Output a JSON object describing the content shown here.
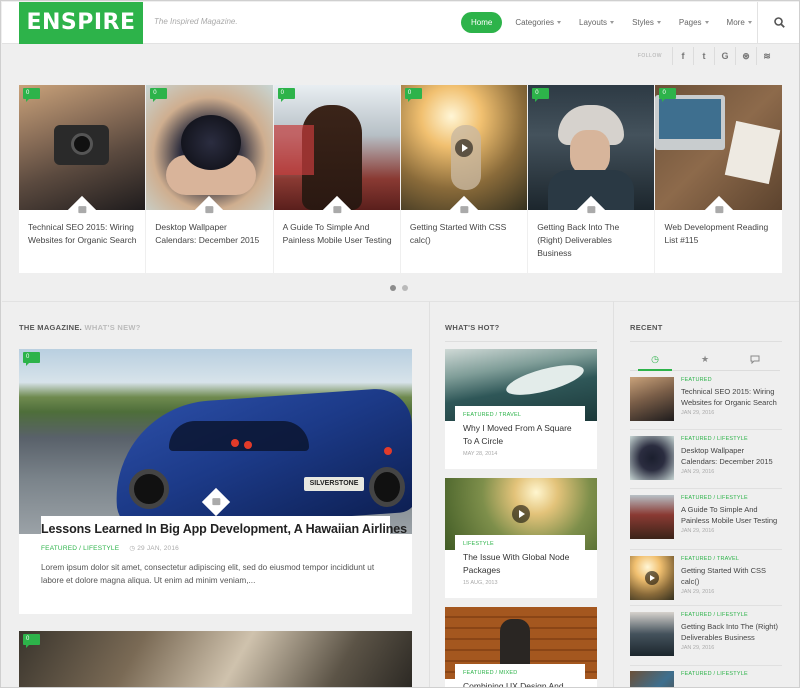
{
  "header": {
    "logo": "ENSPIRE",
    "tagline": "The Inspired Magazine.",
    "nav": [
      {
        "label": "Home",
        "active": true,
        "dropdown": false
      },
      {
        "label": "Categories",
        "active": false,
        "dropdown": true
      },
      {
        "label": "Layouts",
        "active": false,
        "dropdown": true
      },
      {
        "label": "Styles",
        "active": false,
        "dropdown": true
      },
      {
        "label": "Pages",
        "active": false,
        "dropdown": true
      },
      {
        "label": "More",
        "active": false,
        "dropdown": true
      }
    ],
    "search_icon": "search-icon"
  },
  "follow": {
    "label": "FOLLOW",
    "icons": [
      "facebook-icon",
      "twitter-icon",
      "google-icon",
      "dribbble-icon",
      "rss-icon"
    ],
    "glyphs": [
      "f",
      "t",
      "G",
      "⊛",
      "≋"
    ]
  },
  "slider": {
    "badge_count": "0",
    "items": [
      {
        "title": "Technical SEO 2015: Wiring Websites for Organic Search",
        "type": "photo"
      },
      {
        "title": "Desktop Wallpaper Calendars: December 2015",
        "type": "photo"
      },
      {
        "title": "A Guide To Simple And Painless Mobile User Testing",
        "type": "photo"
      },
      {
        "title": "Getting Started With CSS calc()",
        "type": "video"
      },
      {
        "title": "Getting Back Into The (Right) Deliverables Business",
        "type": "photo"
      },
      {
        "title": "Web Development Reading List #115",
        "type": "photo"
      }
    ],
    "active_dot": 0
  },
  "magazine": {
    "title": "THE MAGAZINE.",
    "subtitle": "WHAT'S NEW?",
    "featured": {
      "title": "Lessons Learned In Big App Development, A Hawaiian Airlines",
      "category": "FEATURED / LIFESTYLE",
      "date": "29 JAN, 2016",
      "excerpt": "Lorem ipsum dolor sit amet, consectetur adipiscing elit, sed do eiusmod tempor incididunt ut labore et dolore magna aliqua. Ut enim ad minim veniam,...",
      "badge_count": "0",
      "plate_text": "SILVERSTONE"
    },
    "second_badge": "0"
  },
  "hot": {
    "title": "WHAT'S HOT?",
    "items": [
      {
        "category": "FEATURED / TRAVEL",
        "title": "Why I Moved From A Square To A Circle",
        "date": "MAY 28, 2014"
      },
      {
        "category": "LIFESTYLE",
        "title": "The Issue With Global Node Packages",
        "date": "15 AUG, 2013"
      },
      {
        "category": "FEATURED / MIXED",
        "title": "Combining UX Design And",
        "date": ""
      }
    ]
  },
  "recent": {
    "title": "RECENT",
    "tabs": [
      "clock-icon",
      "star-icon",
      "comment-icon"
    ],
    "tab_glyphs": [
      "◷",
      "★",
      "💬"
    ],
    "items": [
      {
        "category": "FEATURED",
        "title": "Technical SEO 2015: Wiring Websites for Organic Search",
        "date": "JAN 29, 2016"
      },
      {
        "category": "FEATURED / LIFESTYLE",
        "title": "Desktop Wallpaper Calendars: December 2015",
        "date": "JAN 29, 2016"
      },
      {
        "category": "FEATURED / LIFESTYLE",
        "title": "A Guide To Simple And Painless Mobile User Testing",
        "date": "JAN 29, 2016"
      },
      {
        "category": "FEATURED / TRAVEL",
        "title": "Getting Started With CSS calc()",
        "date": "JAN 29, 2016"
      },
      {
        "category": "FEATURED / LIFESTYLE",
        "title": "Getting Back Into The (Right) Deliverables Business",
        "date": "JAN 29, 2016"
      },
      {
        "category": "FEATURED / LIFESTYLE",
        "title": "",
        "date": ""
      }
    ]
  },
  "colors": {
    "accent": "#2db34a"
  }
}
